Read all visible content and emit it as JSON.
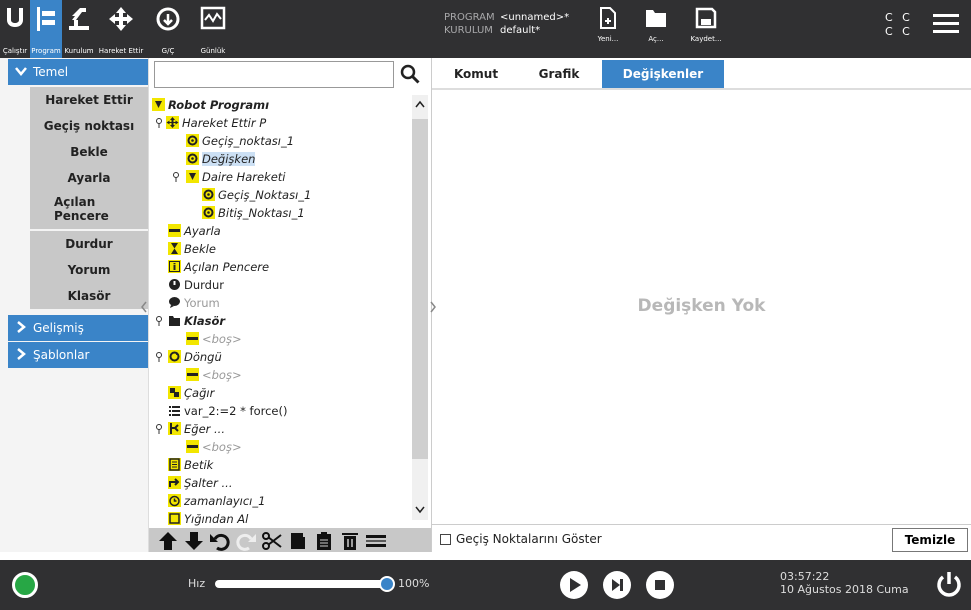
{
  "header": {
    "nav": [
      {
        "label": "Çalıştır",
        "icon": "ur-logo-icon"
      },
      {
        "label": "Program",
        "icon": "program-icon"
      },
      {
        "label": "Kurulum",
        "icon": "installation-icon"
      },
      {
        "label": "Hareket Ettir",
        "icon": "move-icon"
      },
      {
        "label": "G/Ç",
        "icon": "io-icon"
      },
      {
        "label": "Günlük",
        "icon": "log-icon"
      }
    ],
    "program_key": "PROGRAM",
    "program_value": "<unnamed>*",
    "installation_key": "KURULUM",
    "installation_value": "default*",
    "file_buttons": [
      "Yeni...",
      "Aç...",
      "Kaydet..."
    ],
    "cc_line1": "C C",
    "cc_line2": "C C"
  },
  "sidebar": {
    "cat_basic": "Temel",
    "items": [
      "Hareket Ettir",
      "Geçiş noktası",
      "Bekle",
      "Ayarla",
      "Açılan Pencere",
      "Durdur",
      "Yorum",
      "Klasör"
    ],
    "cat_advanced": "Gelişmiş",
    "cat_templates": "Şablonlar"
  },
  "tree": {
    "nodes": [
      {
        "text": "Robot Programı",
        "icon": "program-root-icon"
      },
      {
        "text": "Hareket Ettir P",
        "icon": "move-icon"
      },
      {
        "text": "Geçiş_noktası_1",
        "icon": "waypoint-icon"
      },
      {
        "text": "Değişken",
        "icon": "waypoint-icon"
      },
      {
        "text": "Daire Hareketi",
        "icon": "circle-move-icon"
      },
      {
        "text": "Geçiş_Noktası_1",
        "icon": "waypoint-icon"
      },
      {
        "text": "Bitiş_Noktası_1",
        "icon": "waypoint-icon"
      },
      {
        "text": "Ayarla",
        "icon": "set-icon"
      },
      {
        "text": "Bekle",
        "icon": "hourglass-icon"
      },
      {
        "text": "Açılan Pencere",
        "icon": "popup-icon"
      },
      {
        "text": "Durdur",
        "icon": "stop-icon"
      },
      {
        "text": "Yorum",
        "icon": "comment-icon"
      },
      {
        "text": "Klasör",
        "icon": "folder-icon"
      },
      {
        "text": "<boş>",
        "icon": "empty-icon"
      },
      {
        "text": "Döngü",
        "icon": "loop-icon"
      },
      {
        "text": "<boş>",
        "icon": "empty-icon"
      },
      {
        "text": "Çağır",
        "icon": "call-icon"
      },
      {
        "text": "var_2:=2 * force()",
        "icon": "assignment-icon"
      },
      {
        "text": "Eğer ...",
        "icon": "if-icon"
      },
      {
        "text": "<boş>",
        "icon": "empty-icon"
      },
      {
        "text": "Betik",
        "icon": "script-icon"
      },
      {
        "text": "Şalter ...",
        "icon": "switch-icon"
      },
      {
        "text": "zamanlayıcı_1",
        "icon": "timer-icon"
      },
      {
        "text": "Yığından Al",
        "icon": "palletizing-icon"
      }
    ]
  },
  "tabs": [
    "Komut",
    "Grafik",
    "Değişkenler"
  ],
  "active_tab": "Değişkenler",
  "right": {
    "empty_message": "Değişken Yok",
    "show_waypoints_label": "Geçiş Noktalarını Göster",
    "clear_button": "Temizle"
  },
  "footer": {
    "speed_label": "Hız",
    "speed_value": "100%",
    "speed_fraction": 1.0,
    "time": "03:57:22",
    "date": "10 Ağustos 2018 Cuma"
  },
  "colors": {
    "accent": "#3a84c8",
    "header_bg": "#303032",
    "status_ok": "#27a745",
    "icon_yellow": "#f2e600"
  }
}
